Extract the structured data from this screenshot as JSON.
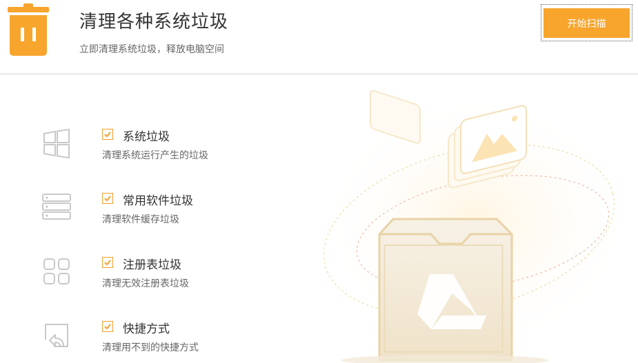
{
  "header": {
    "title": "清理各种系统垃圾",
    "subtitle": "立即清理系统垃圾，释放电脑空间",
    "scan_button": "开始扫描",
    "icon": "trash-can-icon"
  },
  "items": [
    {
      "title": "系统垃圾",
      "desc": "清理系统运行产生的垃圾",
      "checked": true,
      "icon": "windows-icon"
    },
    {
      "title": "常用软件垃圾",
      "desc": "清理软件缓存垃圾",
      "checked": true,
      "icon": "server-stack-icon"
    },
    {
      "title": "注册表垃圾",
      "desc": "清理无效注册表垃圾",
      "checked": true,
      "icon": "registry-grid-icon"
    },
    {
      "title": "快捷方式",
      "desc": "清理用不到的快捷方式",
      "checked": true,
      "icon": "shortcut-icon"
    }
  ],
  "colors": {
    "accent": "#f7a52d",
    "check_border": "#f0a02a",
    "icon_gray": "#c8c8c8"
  }
}
